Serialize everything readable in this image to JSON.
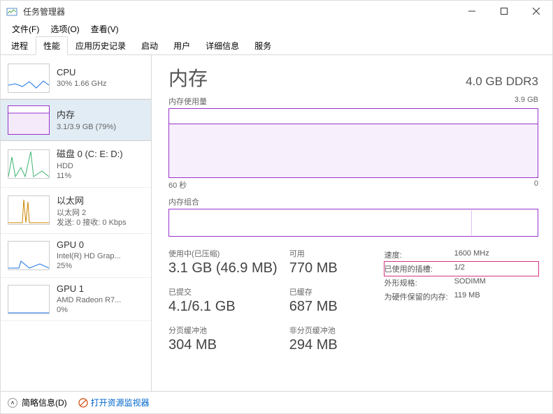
{
  "window": {
    "title": "任务管理器"
  },
  "menu": {
    "file": "文件(F)",
    "options": "选项(O)",
    "view": "查看(V)"
  },
  "tabs": {
    "processes": "进程",
    "performance": "性能",
    "app_history": "应用历史记录",
    "startup": "启动",
    "users": "用户",
    "details": "详细信息",
    "services": "服务"
  },
  "sidebar": [
    {
      "name": "CPU",
      "sub": "30% 1.66 GHz",
      "color": "#1a73e8"
    },
    {
      "name": "内存",
      "sub": "3.1/3.9 GB (79%)",
      "color": "#9933cc"
    },
    {
      "name": "磁盘 0 (C: E: D:)",
      "sub": "HDD\n11%",
      "color": "#3cb371"
    },
    {
      "name": "以太网",
      "sub": "以太网 2\n发送: 0 接收: 0 Kbps",
      "color": "#cc8400"
    },
    {
      "name": "GPU 0",
      "sub": "Intel(R) HD Grap...\n25%",
      "color": "#1a73e8"
    },
    {
      "name": "GPU 1",
      "sub": "AMD Radeon R7...\n0%",
      "color": "#1a73e8"
    }
  ],
  "detail": {
    "title": "内存",
    "spec_title": "4.0 GB DDR3",
    "graph1_left": "内存使用量",
    "graph1_right": "3.9 GB",
    "graph1_bl": "60 秒",
    "graph1_br": "0",
    "graph2_left": "内存组合",
    "stats": {
      "in_use_label": "使用中(已压缩)",
      "in_use_value": "3.1 GB (46.9 MB)",
      "available_label": "可用",
      "available_value": "770 MB",
      "committed_label": "已提交",
      "committed_value": "4.1/6.1 GB",
      "cached_label": "已缓存",
      "cached_value": "687 MB",
      "paged_label": "分页缓冲池",
      "paged_value": "304 MB",
      "nonpaged_label": "非分页缓冲池",
      "nonpaged_value": "294 MB"
    },
    "specs": {
      "speed_label": "速度:",
      "speed_value": "1600 MHz",
      "slots_label": "已使用的插槽:",
      "slots_value": "1/2",
      "form_label": "外形规格:",
      "form_value": "SODIMM",
      "reserved_label": "为硬件保留的内存:",
      "reserved_value": "119 MB"
    }
  },
  "bottom": {
    "fewer_details": "简略信息(D)",
    "open_monitor": "打开资源监视器"
  },
  "chart_data": {
    "type": "area",
    "title": "内存使用量",
    "ylabel": "GB",
    "ylim": [
      0,
      3.9
    ],
    "x_range_seconds": [
      60,
      0
    ],
    "series": [
      {
        "name": "内存使用量",
        "approx_constant_value": 3.1
      }
    ]
  }
}
